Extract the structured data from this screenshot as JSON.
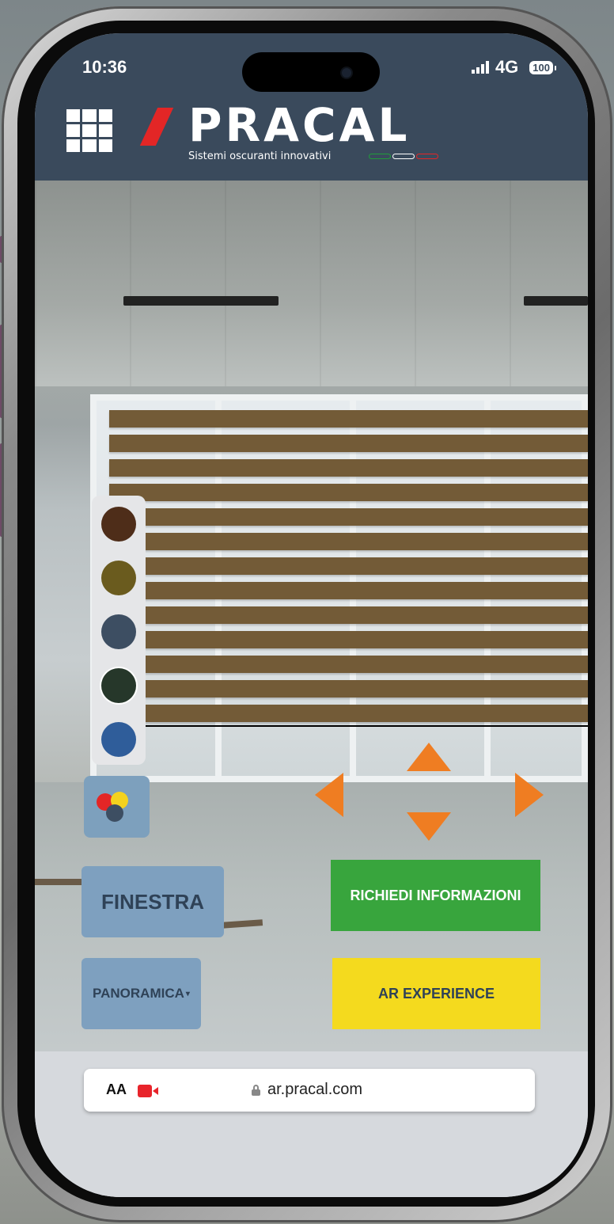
{
  "status_bar": {
    "time": "10:36",
    "network": "4G",
    "battery": "100"
  },
  "header": {
    "brand": "PRACAL",
    "tagline": "Sistemi oscuranti innovativi",
    "flag_colors": [
      "#1f9d3a",
      "#ffffff",
      "#e32626"
    ]
  },
  "colors": {
    "header_bg": "#3a4a5c",
    "slat": "#735b37",
    "arrow": "#ef7d22",
    "info_button": "#38a53d",
    "ar_button": "#f4da1e",
    "secondary_button": "#7ea0bf"
  },
  "palette": {
    "swatches": [
      "#4e2d19",
      "#6a5b1e",
      "#3d4e62",
      "#26372a",
      "#2f5d9a"
    ],
    "selected_index": 3
  },
  "color_mix_icon": {
    "dots": [
      "#e32626",
      "#f4d21e",
      "#3d4e62"
    ]
  },
  "controls": {
    "finestra_label": "FINESTRA",
    "panoramica_label": "PANORAMICA",
    "info_label": "RICHIEDI INFORMAZIONI",
    "ar_label": "AR EXPERIENCE"
  },
  "browser": {
    "aa_label": "AA",
    "url": "ar.pracal.com"
  }
}
